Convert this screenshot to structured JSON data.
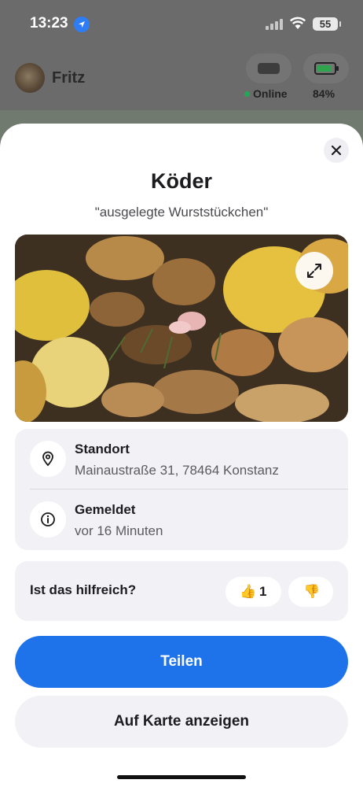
{
  "status_bar": {
    "time": "13:23",
    "battery": "55"
  },
  "header": {
    "pet_name": "Fritz",
    "device_status": "Online",
    "battery_percent": "84%"
  },
  "sheet": {
    "title": "Köder",
    "subtitle": "\"ausgelegte Wurststückchen\"",
    "location": {
      "label": "Standort",
      "value": "Mainaustraße 31, 78464 Konstanz"
    },
    "reported": {
      "label": "Gemeldet",
      "value": "vor 16 Minuten"
    },
    "feedback": {
      "question": "Ist das hilfreich?",
      "upvote_icon": "👍",
      "upvotes": "1",
      "downvote_icon": "👎"
    },
    "share_button": "Teilen",
    "map_button": "Auf Karte anzeigen"
  },
  "colors": {
    "accent": "#1f73ea",
    "online": "#23a55a",
    "card_bg": "#f2f2f6"
  },
  "icons": [
    "location-arrow-icon",
    "signal-icon",
    "wifi-icon",
    "battery-icon",
    "tracker-device-icon",
    "close-icon",
    "expand-icon",
    "map-pin-icon",
    "info-icon",
    "thumbs-up-icon",
    "thumbs-down-icon"
  ]
}
